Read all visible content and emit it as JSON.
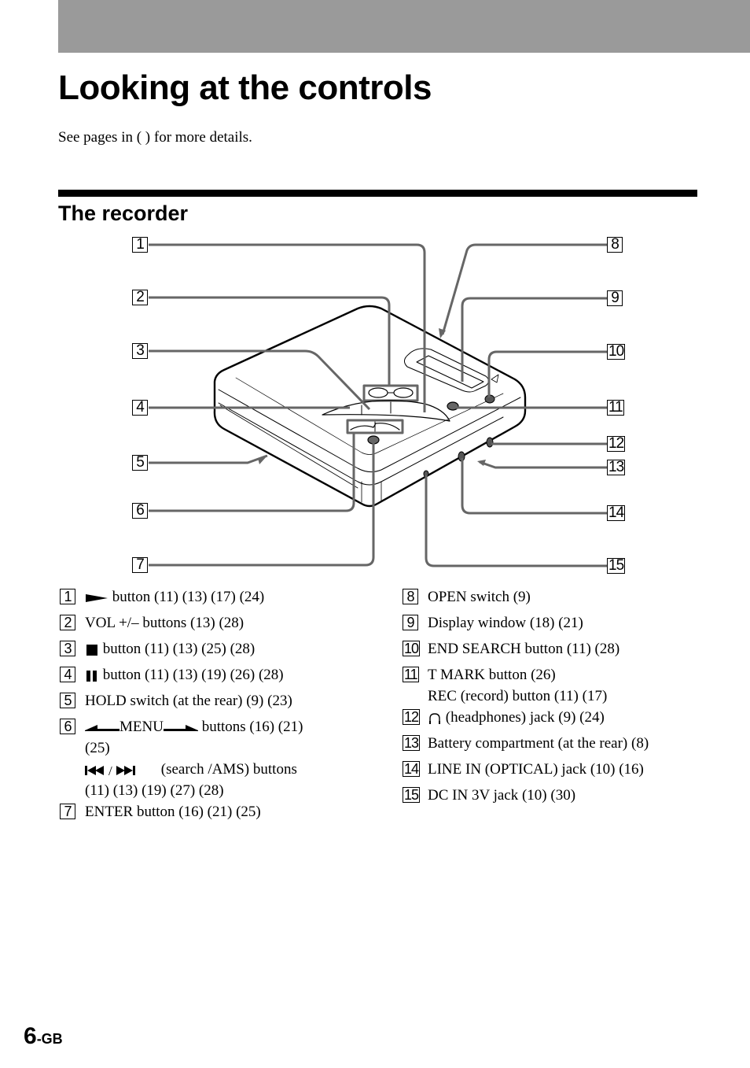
{
  "page": {
    "title": "Looking at the controls",
    "intro": "See pages in ( ) for more details.",
    "section_title": "The recorder",
    "footer": {
      "page_number": "6",
      "suffix": "-GB"
    }
  },
  "diagram": {
    "callouts_left": [
      "1",
      "2",
      "3",
      "4",
      "5",
      "6",
      "7"
    ],
    "callouts_right": [
      "8",
      "9",
      "10",
      "11",
      "12",
      "13",
      "14",
      "15"
    ]
  },
  "legend": {
    "left": [
      {
        "num": "1",
        "icon": "play-icon",
        "text": "button  (11) (13) (17) (24)"
      },
      {
        "num": "2",
        "text": "VOL +/– buttons  (13) (28)"
      },
      {
        "num": "3",
        "icon": "stop-icon",
        "text": "button  (11) (13) (25) (28)"
      },
      {
        "num": "4",
        "icon": "pause-icon",
        "text": "button  (11) (13) (19) (26) (28)"
      },
      {
        "num": "5",
        "text": "HOLD switch (at the rear)  (9) (23)"
      },
      {
        "num": "6",
        "icon": "menu-arrows-icon",
        "text": "MENU",
        "text_after": "buttons  (16) (21)",
        "line2": "(25)",
        "line3_icon": "prev-next-icon",
        "line3": "(search /AMS) buttons",
        "line4": "(11) (13) (19) (27) (28)"
      },
      {
        "num": "7",
        "text": "ENTER button  (16) (21) (25)"
      }
    ],
    "right": [
      {
        "num": "8",
        "text": "OPEN switch  (9)"
      },
      {
        "num": "9",
        "text": "Display window  (18) (21)"
      },
      {
        "num": "10",
        "text": "END SEARCH button  (11) (28)"
      },
      {
        "num": "11",
        "text": "T MARK button  (26)",
        "line2": "REC (record) button  (11) (17)"
      },
      {
        "num": "12",
        "icon": "headphones-icon",
        "text": "(headphones) jack  (9) (24)"
      },
      {
        "num": "13",
        "text": "Battery compartment (at the rear)  (8)"
      },
      {
        "num": "14",
        "text": "LINE IN (OPTICAL) jack  (10) (16)"
      },
      {
        "num": "15",
        "text": "DC IN 3V jack  (10) (30)"
      }
    ]
  }
}
